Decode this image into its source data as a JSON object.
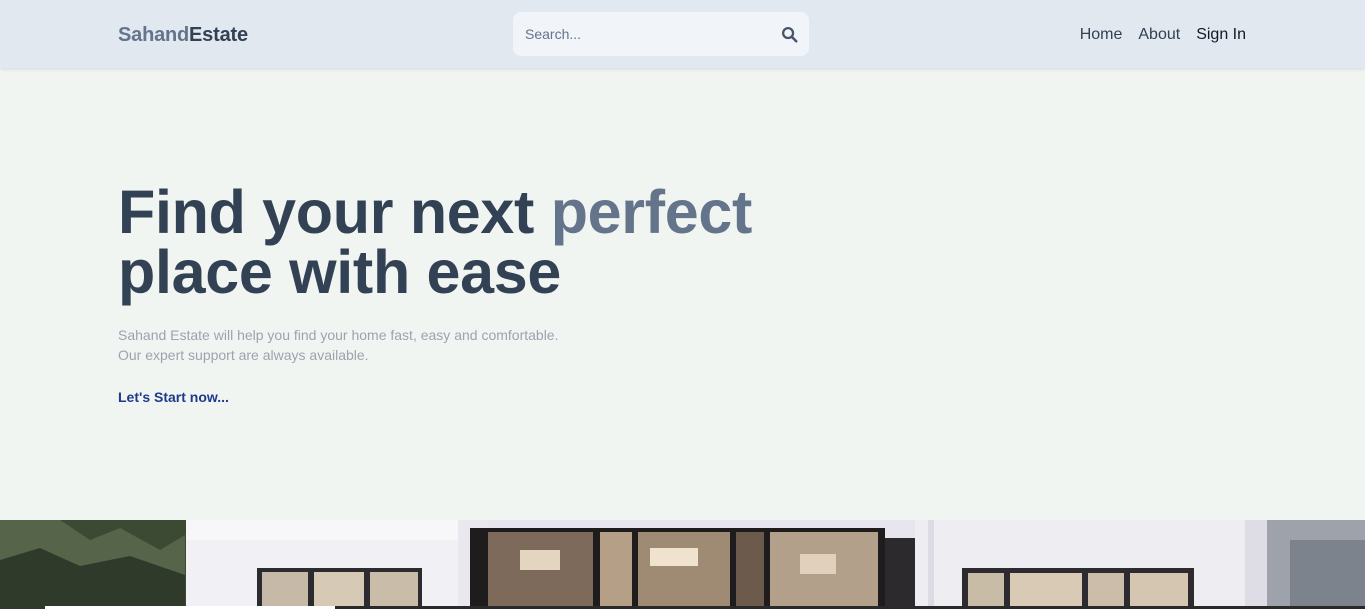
{
  "header": {
    "logo": {
      "part1": "Sahand",
      "part2": "Estate"
    },
    "search": {
      "placeholder": "Search...",
      "value": ""
    },
    "nav": {
      "home": "Home",
      "about": "About",
      "sign_in": "Sign In"
    }
  },
  "hero": {
    "title_line1_start": "Find your next ",
    "title_accent": "perfect",
    "title_line2": "place with ease",
    "subtitle_line1": "Sahand Estate will help you find your home fast, easy and comfortable.",
    "subtitle_line2": "Our expert support are always available.",
    "cta": "Let's Start now..."
  },
  "icons": {
    "search": "search-icon"
  }
}
